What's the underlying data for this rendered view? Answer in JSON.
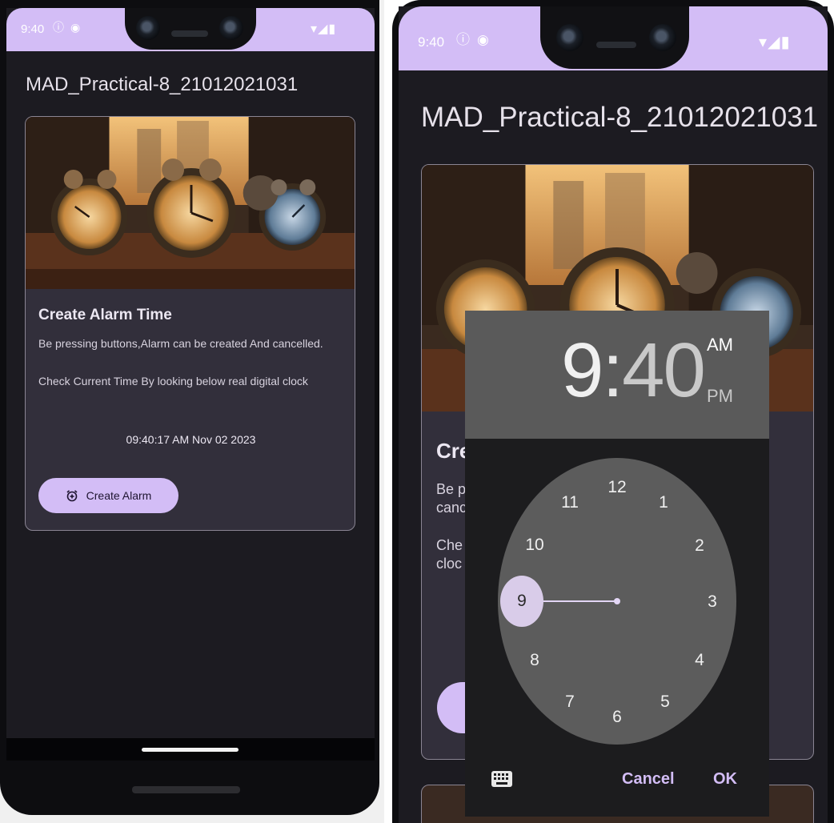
{
  "status_bar": {
    "time": "9:40",
    "icons": [
      "info-icon",
      "notification-icon"
    ],
    "right_icons": [
      "wifi-icon",
      "signal-icon",
      "battery-icon"
    ]
  },
  "app": {
    "title": "MAD_Practical-8_21012021031"
  },
  "card": {
    "title": "Create Alarm Time",
    "text1": "Be pressing buttons,Alarm can be created And cancelled.",
    "text2": "Check Current Time By looking below real digital clock",
    "clock": "09:40:17 AM Nov 02 2023",
    "button_label": "Create Alarm"
  },
  "right_card": {
    "title_partial": "Cre",
    "text1_line1": "Be p",
    "text1_line2": "canc",
    "text2_line1": "Che",
    "text2_line2": "cloc"
  },
  "time_picker": {
    "hour": "9",
    "colon": ":",
    "minute": "40",
    "am_label": "AM",
    "pm_label": "PM",
    "selected_hour": "9",
    "dial_numbers": [
      "12",
      "1",
      "2",
      "3",
      "4",
      "5",
      "6",
      "7",
      "8",
      "10",
      "11"
    ],
    "cancel_label": "Cancel",
    "ok_label": "OK"
  },
  "colors": {
    "accent": "#d3bdf6",
    "surface": "#1c1b21",
    "card": "#322f3b",
    "dial": "#5c5c5c"
  }
}
